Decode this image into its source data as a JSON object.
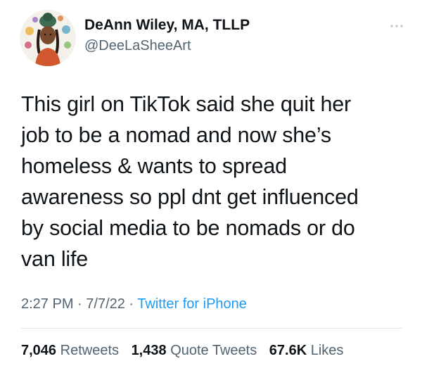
{
  "author": {
    "display_name": "DeAnn Wiley, MA, TLLP",
    "handle": "@DeeLaSheeArt",
    "avatar_icon": "profile-avatar"
  },
  "more_icon": "more-options-icon",
  "tweet": {
    "lines": [
      "This girl on TikTok said she quit her",
      "job to be a nomad and now she’s",
      "homeless & wants to spread",
      "awareness so ppl dnt get influenced",
      "by social media to be nomads or do",
      "van life"
    ]
  },
  "meta": {
    "time": "2:27 PM",
    "sep1": " · ",
    "date": "7/7/22",
    "sep2": " · ",
    "source": "Twitter for iPhone"
  },
  "stats": {
    "retweets": {
      "count": "7,046",
      "label": "Retweets"
    },
    "quotes": {
      "count": "1,438",
      "label": "Quote Tweets"
    },
    "likes": {
      "count": "67.6K",
      "label": "Likes"
    }
  },
  "colors": {
    "text": "#0f1419",
    "secondary": "#536471",
    "link": "#1d9bf0",
    "divider": "#e1e6ea"
  }
}
